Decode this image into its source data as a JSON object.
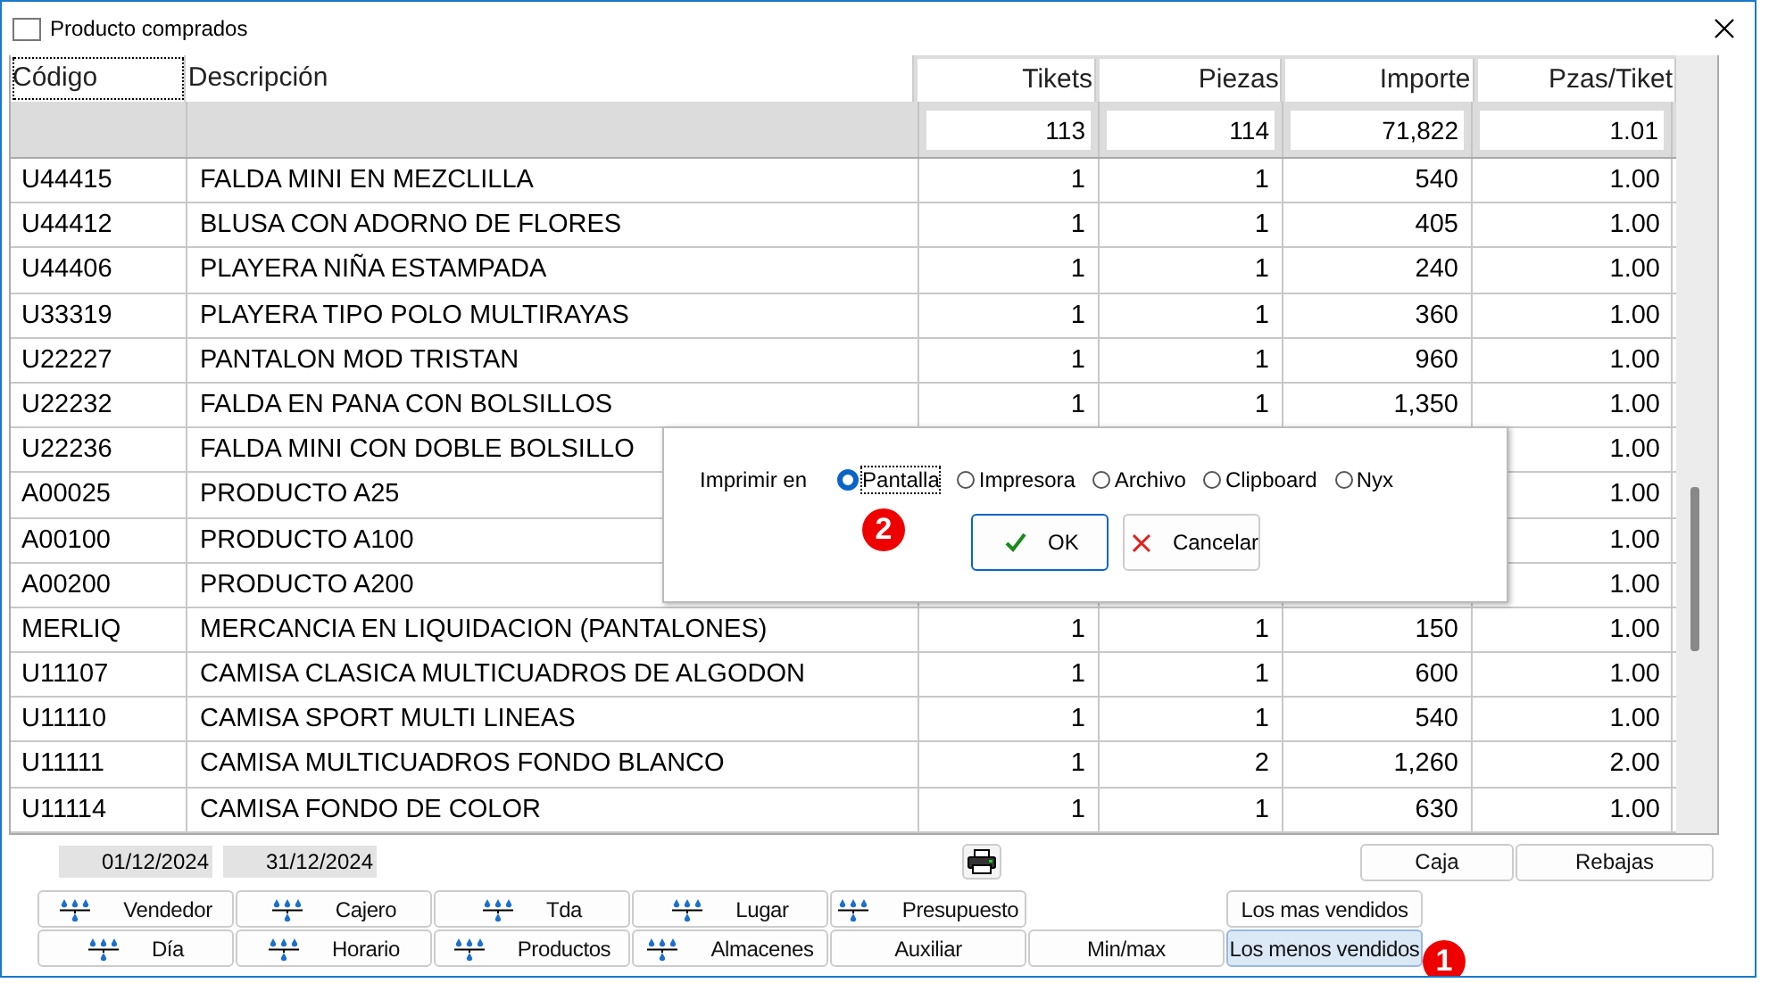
{
  "window": {
    "title": "Producto comprados"
  },
  "table": {
    "columns": [
      "Código",
      "Descripción",
      "Tikets",
      "Piezas",
      "Importe",
      "Pzas/Tiket"
    ],
    "totals": [
      "113",
      "114",
      "71,822",
      "1.01"
    ],
    "rows": [
      {
        "code": "U44415",
        "description": "FALDA MINI EN MEZCLILLA",
        "tikets": "1",
        "piezas": "1",
        "importe": "540",
        "pzas_tiket": "1.00"
      },
      {
        "code": "U44412",
        "description": "BLUSA CON ADORNO DE FLORES",
        "tikets": "1",
        "piezas": "1",
        "importe": "405",
        "pzas_tiket": "1.00"
      },
      {
        "code": "U44406",
        "description": "PLAYERA NIÑA ESTAMPADA",
        "tikets": "1",
        "piezas": "1",
        "importe": "240",
        "pzas_tiket": "1.00"
      },
      {
        "code": "U33319",
        "description": "PLAYERA TIPO POLO MULTIRAYAS",
        "tikets": "1",
        "piezas": "1",
        "importe": "360",
        "pzas_tiket": "1.00"
      },
      {
        "code": "U22227",
        "description": "PANTALON MOD TRISTAN",
        "tikets": "1",
        "piezas": "1",
        "importe": "960",
        "pzas_tiket": "1.00"
      },
      {
        "code": "U22232",
        "description": "FALDA EN PANA CON BOLSILLOS",
        "tikets": "1",
        "piezas": "1",
        "importe": "1,350",
        "pzas_tiket": "1.00"
      },
      {
        "code": "U22236",
        "description": "FALDA MINI CON DOBLE BOLSILLO",
        "pzas_tiket": "1.00"
      },
      {
        "code": "A00025",
        "description": "PRODUCTO A25",
        "pzas_tiket": "1.00"
      },
      {
        "code": "A00100",
        "description": "PRODUCTO A100",
        "pzas_tiket": "1.00"
      },
      {
        "code": "A00200",
        "description": "PRODUCTO A200",
        "pzas_tiket": "1.00"
      },
      {
        "code": "MERLIQ",
        "description": "MERCANCIA EN LIQUIDACION (PANTALONES)",
        "tikets": "1",
        "piezas": "1",
        "importe": "150",
        "pzas_tiket": "1.00"
      },
      {
        "code": "U11107",
        "description": "CAMISA CLASICA MULTICUADROS DE ALGODON",
        "tikets": "1",
        "piezas": "1",
        "importe": "600",
        "pzas_tiket": "1.00"
      },
      {
        "code": "U11110",
        "description": "CAMISA SPORT MULTI LINEAS",
        "tikets": "1",
        "piezas": "1",
        "importe": "540",
        "pzas_tiket": "1.00"
      },
      {
        "code": "U11111",
        "description": "CAMISA MULTICUADROS FONDO BLANCO",
        "tikets": "1",
        "piezas": "2",
        "importe": "1,260",
        "pzas_tiket": "2.00"
      },
      {
        "code": "U11114",
        "description": "CAMISA FONDO DE COLOR",
        "tikets": "1",
        "piezas": "1",
        "importe": "630",
        "pzas_tiket": "1.00"
      }
    ]
  },
  "dialog": {
    "label": "Imprimir en",
    "options": [
      {
        "label": "Pantalla",
        "selected": true
      },
      {
        "label": "Impresora",
        "selected": false
      },
      {
        "label": "Archivo",
        "selected": false
      },
      {
        "label": "Clipboard",
        "selected": false
      },
      {
        "label": "Nyx",
        "selected": false
      }
    ],
    "buttons": [
      {
        "label": "OK",
        "kind": "ok"
      },
      {
        "label": "Cancelar",
        "kind": "cancel"
      }
    ],
    "badge": "2"
  },
  "dates": [
    "01/12/2024",
    "31/12/2024"
  ],
  "side_buttons": [
    "Caja",
    "Rebajas"
  ],
  "button_rows": [
    [
      {
        "label": "Vendedor",
        "kind": "drops",
        "selected": false
      },
      {
        "label": "Cajero",
        "kind": "drops",
        "selected": false
      },
      {
        "label": "Tda",
        "kind": "drops",
        "selected": false
      },
      {
        "label": "Lugar",
        "kind": "drops",
        "selected": false
      },
      {
        "label": "Presupuesto",
        "kind": "drops",
        "selected": false
      },
      {
        "label": "Los mas vendidos",
        "kind": "plain",
        "selected": false
      }
    ],
    [
      {
        "label": "Día",
        "kind": "drops",
        "selected": false
      },
      {
        "label": "Horario",
        "kind": "drops",
        "selected": false
      },
      {
        "label": "Productos",
        "kind": "drops",
        "selected": false
      },
      {
        "label": "Almacenes",
        "kind": "drops",
        "selected": false
      },
      {
        "label": "Auxiliar",
        "kind": "plain",
        "selected": false
      },
      {
        "label": "Min/max",
        "kind": "plain",
        "selected": false
      },
      {
        "label": "Los menos vendidos",
        "kind": "plain",
        "selected": true
      }
    ]
  ],
  "badge": "1"
}
